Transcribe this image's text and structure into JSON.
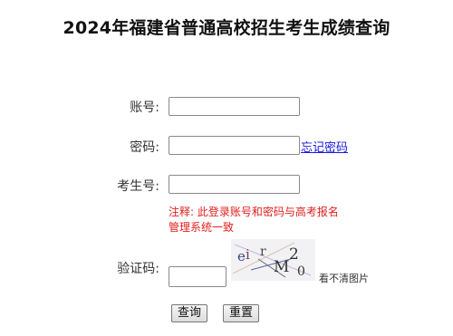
{
  "page": {
    "title": "2024年福建省普通高校招生考生成绩查询"
  },
  "form": {
    "account_label": "账号:",
    "account_value": "",
    "password_label": "密码:",
    "password_value": "",
    "forgot_password_link": "忘记密码",
    "exam_no_label": "考生号:",
    "exam_no_value": "",
    "note_line1": "注释: 此登录账号和密码与高考报名",
    "note_line2": "管理系统一致",
    "captcha_label": "验证码:",
    "captcha_value": "",
    "captcha_image_text": "ei rM20",
    "captcha_refresh_link": "看不清图片",
    "query_button": "查询",
    "reset_button": "重置"
  },
  "colors": {
    "note": "#e0201e",
    "link": "#1a1ae0"
  }
}
